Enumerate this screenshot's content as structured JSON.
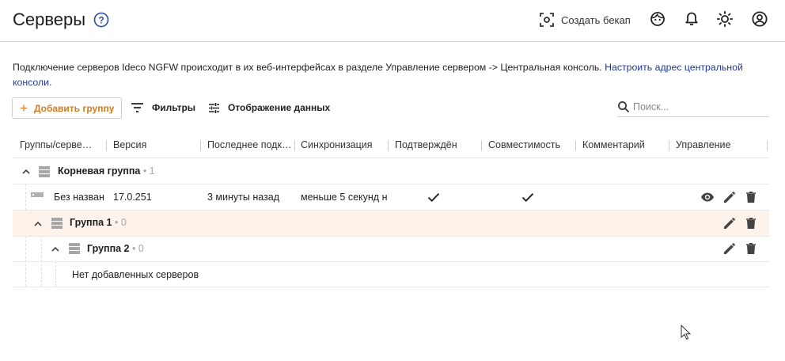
{
  "header": {
    "title": "Серверы",
    "backup_label": "Создать бекап"
  },
  "info": {
    "text": "Подключение серверов Ideco NGFW происходит в их веб-интерфейсах в разделе Управление сервером -> Центральная консоль. ",
    "link": "Настроить адрес центральной консоли."
  },
  "toolbar": {
    "add_group": "Добавить группу",
    "filters": "Фильтры",
    "display": "Отображение данных",
    "search_placeholder": "Поиск..."
  },
  "table": {
    "columns": [
      "Группы/серве…",
      "Версия",
      "Последнее подк…",
      "Синхронизация",
      "Подтверждён",
      "Совместимость",
      "Комментарий",
      "Управление"
    ],
    "root_group": {
      "name": "Корневая группа",
      "count": "• 1"
    },
    "server": {
      "name": "Без назван",
      "version": "17.0.251",
      "last_connect": "3 минуты назад",
      "sync": "меньше 5 секунд н"
    },
    "group1": {
      "name": "Группа 1",
      "count": "• 0"
    },
    "group2": {
      "name": "Группа 2",
      "count": "• 0"
    },
    "empty_text": "Нет добавленных серверов"
  },
  "colors": {
    "accent": "#d47b1e",
    "link": "#1f3a93",
    "highlight_row": "#fdf3ea"
  }
}
